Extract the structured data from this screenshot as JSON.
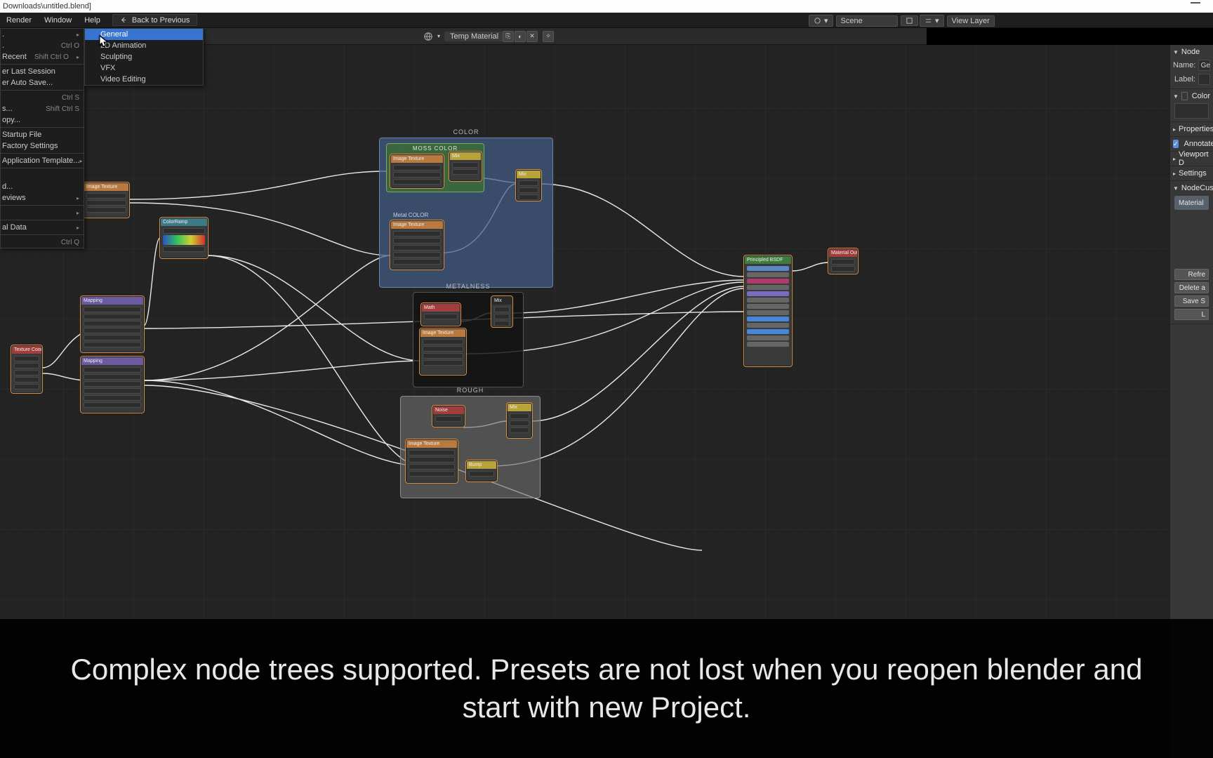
{
  "title_path": "Downloads\\untitled.blend]",
  "menubar": {
    "render": "Render",
    "window": "Window",
    "help": "Help",
    "back": "Back to Previous"
  },
  "top": {
    "scene": "Scene",
    "viewlayer": "View Layer"
  },
  "hdr2": {
    "material": "Temp Material"
  },
  "file_menu": {
    "open_sc": "Ctrl O",
    "recent": "Recent",
    "recent_sc": "Shift Ctrl O",
    "recover_session": "er Last Session",
    "recover_autosave": "er Auto Save...",
    "save_sc": "Ctrl S",
    "save_as": "s...",
    "save_as_sc": "Shift Ctrl S",
    "save_copy": "opy...",
    "startup": "Startup File",
    "factory": "Factory Settings",
    "app_template": "Application Template...",
    "import": "d...",
    "previews": "eviews",
    "external": "al Data",
    "quit_sc": "Ctrl Q"
  },
  "submenu": {
    "general": "General",
    "anim": "2D Animation",
    "sculpt": "Sculpting",
    "vfx": "VFX",
    "video": "Video Editing"
  },
  "npanel": {
    "node": "Node",
    "name": "Name:",
    "name_val": "Ge",
    "label": "Label:",
    "color": "Color",
    "properties": "Properties",
    "annotate": "Annotate",
    "viewport": "Viewport D",
    "settings": "Settings",
    "custom": "NodeCusto",
    "material": "Material",
    "refresh": "Refre",
    "delete": "Delete a",
    "save": "Save S",
    "last": "L"
  },
  "frames": {
    "color": "COLOR",
    "moss": "Moss COLOR",
    "metal": "Metal COLOR",
    "metalness": "METALNESS",
    "rough": "ROUGH"
  },
  "nodes": {
    "texcoord": "Texture Coord",
    "mapping": "Mapping",
    "colorramp": "ColorRamp",
    "imgtex": "Image Texture",
    "mix": "Mix",
    "principled": "Principled BSDF",
    "matout": "Material Output",
    "noise": "Noise",
    "bump": "Bump",
    "math": "Math"
  },
  "caption": "Complex node trees supported. Presets are not lost when you reopen blender and start with new Project."
}
